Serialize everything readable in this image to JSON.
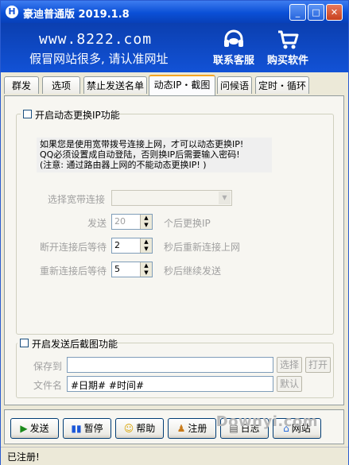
{
  "window": {
    "title": "豪迪普通版 2019.1.8",
    "app_icon": "H"
  },
  "banner": {
    "url": "www.8222.com",
    "slogan": "假冒网站很多, 请认准网址",
    "service_label": "联系客服",
    "buy_label": "购买软件"
  },
  "tabs": [
    {
      "label": "群发"
    },
    {
      "label": "选项"
    },
    {
      "label": "禁止发送名单"
    },
    {
      "label": "动态IP・截图"
    },
    {
      "label": "问候语"
    },
    {
      "label": "定时・循环"
    }
  ],
  "active_tab": "动态IP・截图",
  "dynamic_ip": {
    "title": "开启动态更换IP功能",
    "enabled": false,
    "info": "如果您是使用宽带拨号连接上网，才可以动态更换IP!\nQQ必须设置成自动登陆，否则换IP后需要输入密码!\n(注意: 通过路由器上网的不能动态更换IP! )",
    "broadband_label": "选择宽带连接",
    "broadband_value": "",
    "send_label": "发送",
    "send_value": "20",
    "send_suffix": "个后更换IP",
    "disconnect_label": "断开连接后等待",
    "disconnect_value": "2",
    "disconnect_suffix": "秒后重新连接上网",
    "reconnect_label": "重新连接后等待",
    "reconnect_value": "5",
    "reconnect_suffix": "秒后继续发送"
  },
  "screenshot": {
    "title": "开启发送后截图功能",
    "enabled": false,
    "save_label": "保存到",
    "save_value": "",
    "choose_label": "选择",
    "open_label": "打开",
    "filename_label": "文件名",
    "filename_value": "#日期# #时间#",
    "default_label": "默认"
  },
  "actions": {
    "send": "发送",
    "pause": "暂停",
    "help": "帮助",
    "register": "注册",
    "log": "日志",
    "website": "网站"
  },
  "status": {
    "text": "已注册!"
  },
  "watermark": "Downyi.com",
  "colors": {
    "titlebar": "#0a4fd6",
    "banner": "#1252d6",
    "active_tab_accent": "#f5a623"
  }
}
